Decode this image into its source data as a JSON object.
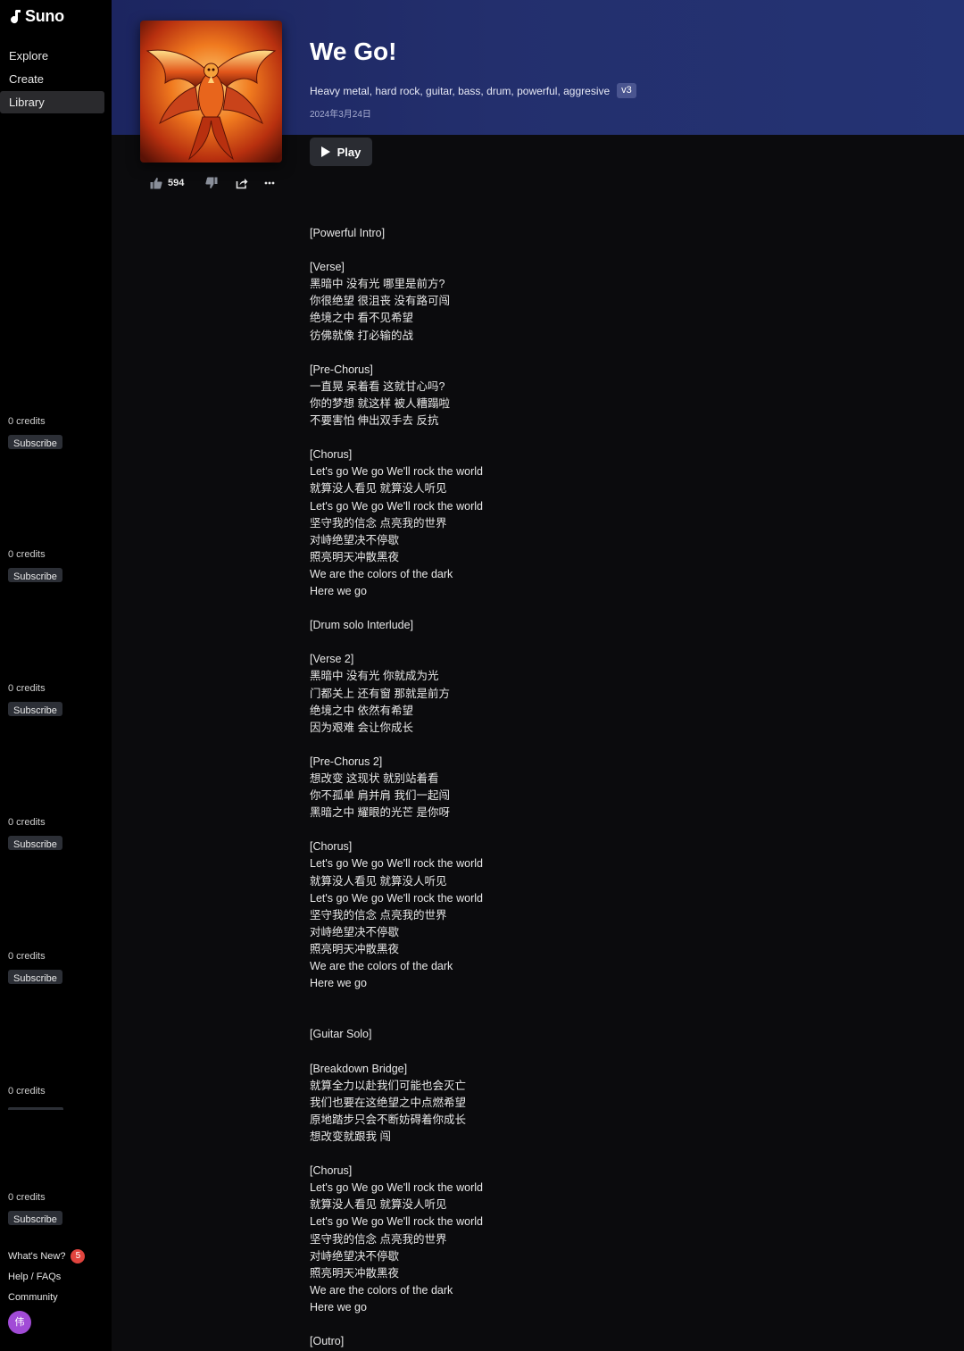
{
  "sidebar": {
    "brand": "Suno",
    "nav": [
      {
        "label": "Explore",
        "active": false
      },
      {
        "label": "Create",
        "active": false
      },
      {
        "label": "Library",
        "active": true
      }
    ],
    "credits_label": "0 credits",
    "subscribe_label": "Subscribe",
    "whats_new": "What's New?",
    "whats_new_count": "5",
    "help": "Help / FAQs",
    "community": "Community",
    "avatar_initial": "伟"
  },
  "song": {
    "title": "We Go!",
    "tags": "Heavy metal, hard rock, guitar, bass, drum, powerful, aggresive",
    "version": "v3",
    "date": "2024年3月24日",
    "play_label": "Play",
    "likes": "594",
    "lyrics": "[Powerful Intro]\n\n[Verse]\n黑暗中 没有光 哪里是前方?\n你很绝望 很沮丧 没有路可闯\n绝境之中 看不见希望\n彷佛就像 打必输的战\n\n[Pre-Chorus]\n一直晃 呆着看 这就甘心吗?\n你的梦想 就这样 被人糟蹋啦\n不要害怕 伸出双手去 反抗\n\n[Chorus]\nLet's go We go We'll rock the world\n就算没人看见 就算没人听见\nLet's go We go We'll rock the world\n坚守我的信念 点亮我的世界\n对峙绝望决不停歇\n照亮明天冲散黑夜\nWe are the colors of the dark\nHere we go\n\n[Drum solo Interlude]\n\n[Verse 2]\n黑暗中 没有光 你就成为光\n门都关上 还有窗 那就是前方\n绝境之中 依然有希望\n因为艰难 会让你成长\n\n[Pre-Chorus 2]\n想改变 这现状 就别站着看\n你不孤单 肩并肩 我们一起闯\n黑暗之中 耀眼的光芒 是你呀\n\n[Chorus]\nLet's go We go We'll rock the world\n就算没人看见 就算没人听见\nLet's go We go We'll rock the world\n坚守我的信念 点亮我的世界\n对峙绝望决不停歇\n照亮明天冲散黑夜\nWe are the colors of the dark\nHere we go\n\n\n[Guitar Solo]\n\n[Breakdown Bridge]\n就算全力以赴我们可能也会灭亡\n我们也要在这绝望之中点燃希望\n原地踏步只会不断妨碍着你成长\n想改变就跟我 闯\n\n[Chorus]\nLet's go We go We'll rock the world\n就算没人看见 就算没人听见\nLet's go We go We'll rock the world\n坚守我的信念 点亮我的世界\n对峙绝望决不停歇\n照亮明天冲散黑夜\nWe are the colors of the dark\nHere we go\n\n[Outro]"
  },
  "icons": {
    "logo": "suno-logo-icon",
    "like": "thumbs-up-icon",
    "dislike": "thumbs-down-icon",
    "share": "share-icon",
    "more": "more-icon",
    "play": "play-icon"
  }
}
